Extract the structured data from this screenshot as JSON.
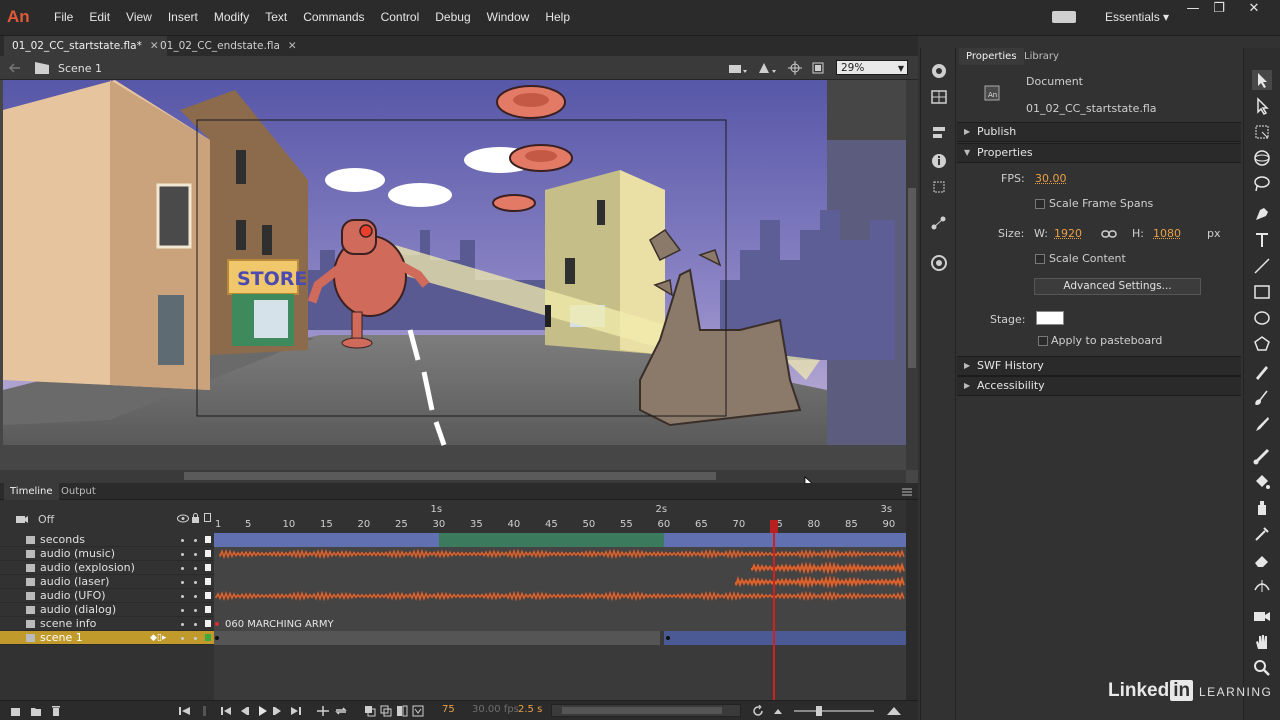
{
  "app": {
    "logo": "An",
    "menus": [
      "File",
      "Edit",
      "View",
      "Insert",
      "Modify",
      "Text",
      "Commands",
      "Control",
      "Debug",
      "Window",
      "Help"
    ],
    "workspace": "Essentials",
    "workspace_caret": "▾",
    "window_controls": [
      "—",
      "❐",
      "✕"
    ]
  },
  "documents": {
    "tabs": [
      {
        "label": "01_02_CC_startstate.fla*",
        "close": "✕"
      },
      {
        "label": "01_02_CC_endstate.fla",
        "close": "✕"
      }
    ]
  },
  "scene_bar": {
    "scene": "Scene 1",
    "zoom": "29%"
  },
  "stage": {
    "store_sign": "STORE"
  },
  "properties_panel": {
    "tabs": [
      "Properties",
      "Library"
    ],
    "document_label": "Document",
    "document_name": "01_02_CC_startstate.fla",
    "sections": {
      "publish": "Publish",
      "properties": "Properties",
      "swf_history": "SWF History",
      "accessibility": "Accessibility"
    },
    "fps_label": "FPS:",
    "fps_value": "30.00",
    "scale_frame_spans": "Scale Frame Spans",
    "size_label": "Size:",
    "w_label": "W:",
    "w_value": "1920",
    "h_label": "H:",
    "h_value": "1080",
    "unit": "px",
    "scale_content": "Scale Content",
    "advanced_settings": "Advanced Settings...",
    "stage_label": "Stage:",
    "stage_color": "#ffffff",
    "apply_to_pasteboard": "Apply to pasteboard"
  },
  "timeline": {
    "tabs": [
      "Timeline",
      "Output"
    ],
    "camera_toggle": "Off",
    "seconds_markers": [
      "1s",
      "2s",
      "3s"
    ],
    "frame_numbers": [
      "1",
      "5",
      "10",
      "15",
      "20",
      "25",
      "30",
      "35",
      "40",
      "45",
      "50",
      "55",
      "60",
      "65",
      "70",
      "75",
      "80",
      "85",
      "90"
    ],
    "playhead_frame": 75,
    "layers": [
      {
        "name": "seconds",
        "selected": false
      },
      {
        "name": "audio (music)",
        "selected": false
      },
      {
        "name": "audio (explosion)",
        "selected": false
      },
      {
        "name": "audio (laser)",
        "selected": false
      },
      {
        "name": "audio (UFO)",
        "selected": false
      },
      {
        "name": "audio (dialog)",
        "selected": false
      },
      {
        "name": "scene info",
        "selected": false
      },
      {
        "name": "scene 1",
        "selected": true
      }
    ],
    "scene_info_label": "060 MARCHING ARMY",
    "current_frame": "75",
    "fps_display": "30.00 fps",
    "time_display": "2.5 s"
  },
  "branding": {
    "linkedin": "Linked",
    "in": "in",
    "learning": "LEARNING"
  },
  "colors": {
    "accent_orange": "#e8a046",
    "selected_layer": "#c09a2a",
    "playhead": "#d02020",
    "audio_wave": "#e0602a",
    "tween_blue": "#4b5a94",
    "sky_top": "#5a5aa8"
  }
}
